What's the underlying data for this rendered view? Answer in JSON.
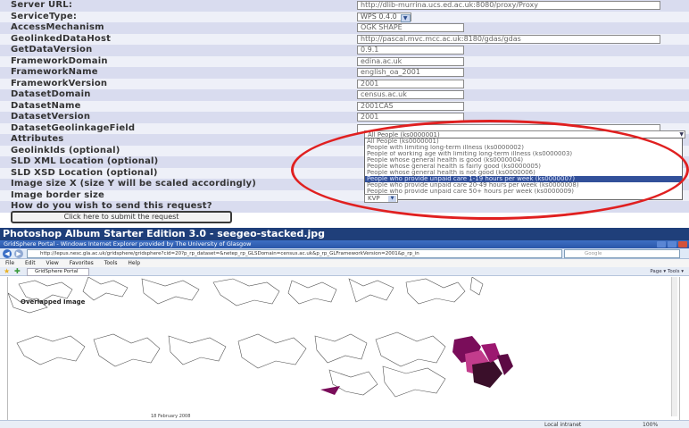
{
  "form": {
    "rows": [
      {
        "label": "Server URL:",
        "value": "http://dlib-murrina.ucs.ed.ac.uk:8080/proxy/Proxy",
        "kind": "input"
      },
      {
        "label": "ServiceType:",
        "value": "WPS 0.4.0",
        "kind": "select"
      },
      {
        "label": "AccessMechanism",
        "value": "OGK SHAPE",
        "kind": "input"
      },
      {
        "label": "GeolinkedDataHost",
        "value": "http://pascal.mvc.mcc.ac.uk:8180/gdas/gdas",
        "kind": "input"
      },
      {
        "label": "GetDataVersion",
        "value": "0.9.1",
        "kind": "input"
      },
      {
        "label": "FrameworkDomain",
        "value": "edina.ac.uk",
        "kind": "input"
      },
      {
        "label": "FrameworkName",
        "value": "english_oa_2001",
        "kind": "input"
      },
      {
        "label": "FrameworkVersion",
        "value": "2001",
        "kind": "input"
      },
      {
        "label": "DatasetDomain",
        "value": "census.ac.uk",
        "kind": "input"
      },
      {
        "label": "DatasetName",
        "value": "2001CAS",
        "kind": "input"
      },
      {
        "label": "DatasetVersion",
        "value": "2001",
        "kind": "input"
      },
      {
        "label": "DatasetGeolinkageField",
        "value": "",
        "kind": "input"
      },
      {
        "label": "Attributes",
        "value": "",
        "kind": "none"
      },
      {
        "label": "GeolinkIds (optional)",
        "value": "",
        "kind": "none"
      },
      {
        "label": "SLD XML Location (optional)",
        "value": "",
        "kind": "none"
      },
      {
        "label": "SLD XSD Location (optional)",
        "value": "",
        "kind": "none"
      },
      {
        "label": "Image size X (size Y will be scaled accordingly)",
        "value": "",
        "kind": "none"
      },
      {
        "label": "Image border size",
        "value": "",
        "kind": "none"
      },
      {
        "label": "How do you wish to send this request?",
        "value": "",
        "kind": "none"
      }
    ],
    "attributes_selected": "All People (ks0000001)",
    "attribute_options": [
      "All People (ks0000001)",
      "People with limiting long-term illness (ks0000002)",
      "People of working age with limiting long-term illness (ks0000003)",
      "People whose general health is good (ks0000004)",
      "People whose general health is fairly good (ks0000005)",
      "People whose general health is not good (ks0000006)",
      "People who provide unpaid care 1-19 hours per week (ks0000007)",
      "People who provide unpaid care 20-49 hours per week (ks0000008)",
      "People who provide unpaid care 50+ hours per week (ks0000009)"
    ],
    "highlighted_option_index": 6,
    "send_method": "KVP",
    "submit_label": "Click here to submit the request",
    "annotation_color": "#e02020"
  },
  "album": {
    "title": "Photoshop Album Starter Edition 3.0 - seegeo-stacked.jpg",
    "browser_title": "GridSphere Portal - Windows Internet Explorer provided by The University of Glasgow",
    "url": "http://lepus.nesc.gla.ac.uk/gridsphere/gridsphere?cid=20?p_rp_dataset=&netep_rp_GLSDomain=census.ac.uk&p_rp_GLFrameworkVersion=2001&p_rp_in",
    "search_placeholder": "Google",
    "menu": [
      "File",
      "Edit",
      "View",
      "Favorites",
      "Tools",
      "Help"
    ],
    "tab_label": "GridSphere Portal",
    "toolbar_right": "Page ▾  Tools ▾",
    "overlap_label": "Overlapped Image",
    "date_stamp": "18 February 2008",
    "status_zone": "Local intranet",
    "status_zoom": "100%",
    "title_color": "#1f3f7a"
  }
}
